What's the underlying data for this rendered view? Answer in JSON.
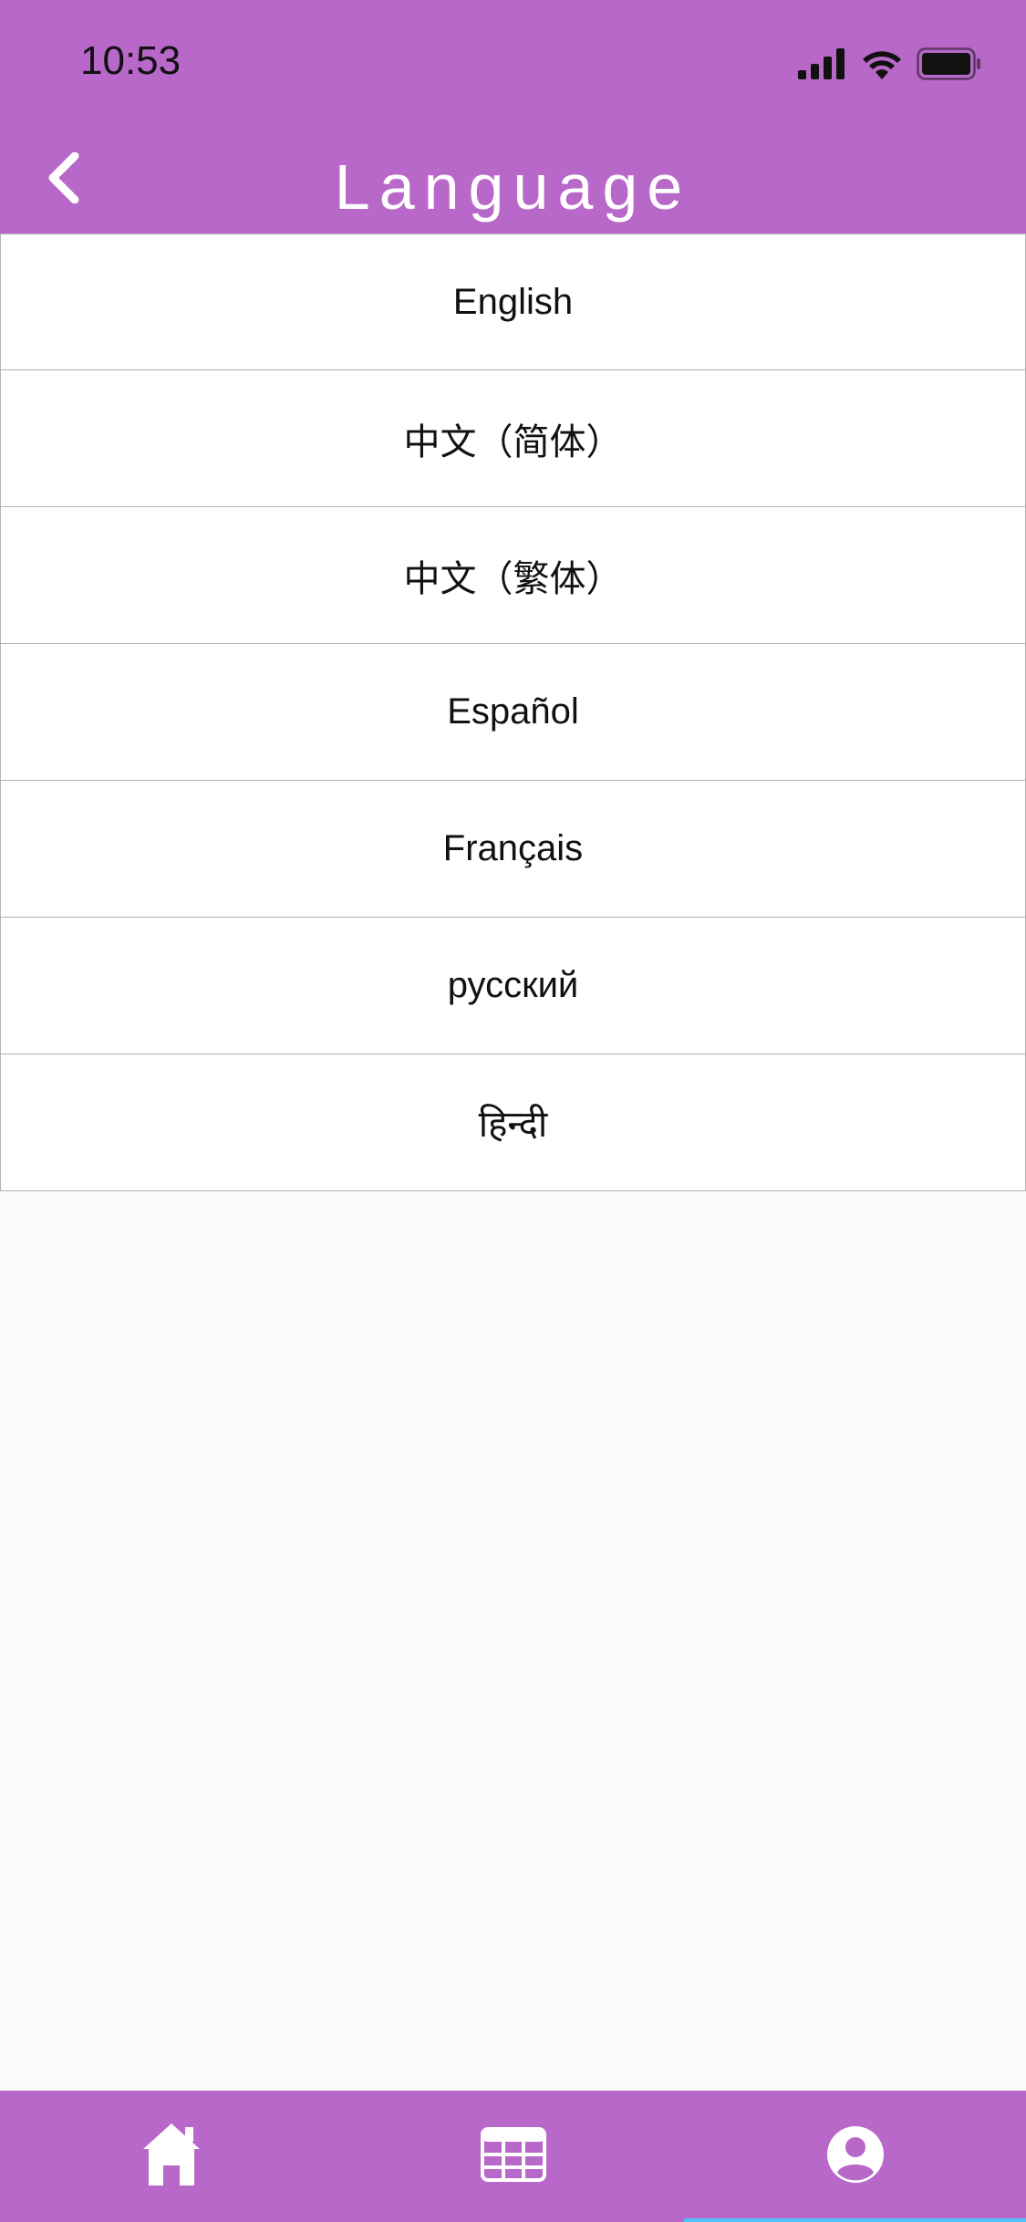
{
  "status_bar": {
    "time": "10:53",
    "icons": [
      "cellular-signal-icon",
      "wifi-icon",
      "battery-icon"
    ]
  },
  "header": {
    "title": "Language",
    "back_icon": "chevron-left-icon"
  },
  "languages": [
    {
      "label": "English"
    },
    {
      "label": "中文（简体）"
    },
    {
      "label": "中文（繁体）"
    },
    {
      "label": "Español"
    },
    {
      "label": "Français"
    },
    {
      "label": "русский"
    },
    {
      "label": "हिन्दी"
    }
  ],
  "tab_bar": {
    "tabs": [
      {
        "icon": "home-icon"
      },
      {
        "icon": "table-icon"
      },
      {
        "icon": "account-icon",
        "active": true
      }
    ]
  },
  "colors": {
    "accent": "#b868c8",
    "active_indicator": "#4fc3f7"
  }
}
